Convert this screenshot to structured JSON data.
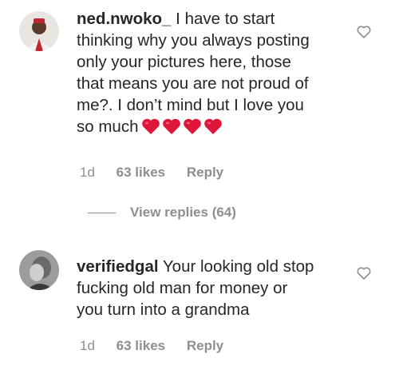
{
  "comments": [
    {
      "username": "ned.nwoko_",
      "text_lines": [
        "I have to start",
        "thinking why you always posting",
        "only your pictures here, those",
        "that means you are not proud of",
        "me?. I don’t mind but I love you",
        "so much"
      ],
      "emoji": [
        "red-heart",
        "red-heart",
        "red-heart",
        "red-heart"
      ],
      "time": "1d",
      "likes": "63 likes",
      "reply": "Reply"
    },
    {
      "username": "verifiedgal",
      "text_lines": [
        "Your looking old stop",
        "fucking old man for money or",
        "you turn into a grandma"
      ],
      "time": "1d",
      "likes": "63 likes",
      "reply": "Reply"
    }
  ],
  "view_replies": "View replies (64)",
  "colors": {
    "text": "#262626",
    "secondary": "#8e8e8e",
    "heart_emoji": "#e0153a"
  },
  "icons": {
    "like": "heart-outline-icon"
  }
}
